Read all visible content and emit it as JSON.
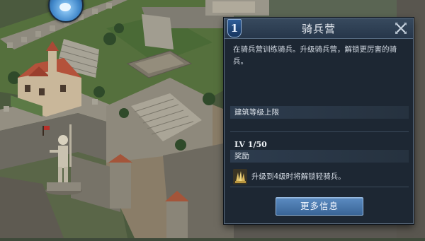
{
  "panel": {
    "level": "1",
    "title": "骑兵营",
    "description": "在骑兵营训练骑兵。升级骑兵营，解锁更厉害的骑兵。",
    "level_cap_header": "建筑等级上限",
    "level_cap_value": "LV 1/50",
    "reward_header": "奖励",
    "reward_text": "升级到4级时将解锁轻骑兵。",
    "more_info_label": "更多信息"
  },
  "icons": {
    "close": "close-icon",
    "reward": "cavalry-reward-icon",
    "avatar": "player-avatar-icon"
  },
  "colors": {
    "panel_bg": "#1d2733",
    "header_bg": "#384a5e",
    "button_bg": "#5b8bc1",
    "badge_bg": "#2f5d99"
  }
}
